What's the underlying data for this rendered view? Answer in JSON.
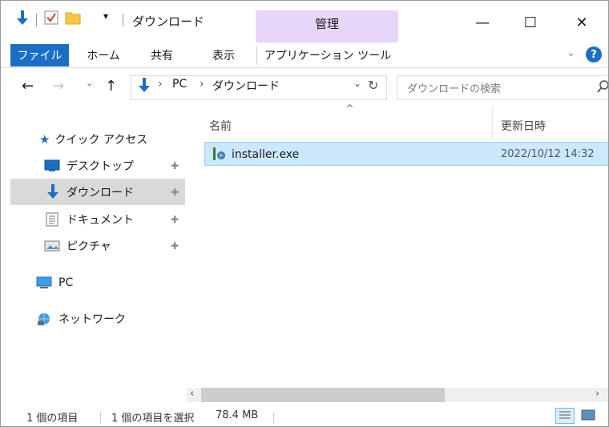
{
  "window": {
    "title": "ダウンロード",
    "context_tab": "管理",
    "controls": {
      "minimize": "—",
      "maximize": "☐",
      "close": "✕"
    }
  },
  "ribbon": {
    "tabs": [
      "ファイル",
      "ホーム",
      "共有",
      "表示",
      "アプリケーション ツール"
    ],
    "help": "?"
  },
  "address_bar": {
    "path": [
      "PC",
      "ダウンロード"
    ],
    "separator": "›"
  },
  "search": {
    "placeholder": "ダウンロードの検索"
  },
  "sidebar": {
    "quick_access": "クイック アクセス",
    "items": [
      {
        "label": "デスクトップ",
        "icon": "desktop-icon",
        "pinned": true
      },
      {
        "label": "ダウンロード",
        "icon": "download-icon",
        "pinned": true,
        "selected": true
      },
      {
        "label": "ドキュメント",
        "icon": "document-icon",
        "pinned": true
      },
      {
        "label": "ピクチャ",
        "icon": "picture-icon",
        "pinned": true
      }
    ],
    "pc": "PC",
    "network": "ネットワーク"
  },
  "file_list": {
    "columns": [
      "名前",
      "更新日時"
    ],
    "rows": [
      {
        "name": "installer.exe",
        "modified": "2022/10/12 14:32",
        "selected": true
      }
    ]
  },
  "status_bar": {
    "count": "1 個の項目",
    "selection": "1 個の項目を選択",
    "size": "78.4 MB"
  },
  "colors": {
    "accent": "#1a6fc4",
    "selection": "#cce8ff",
    "context_tab": "#e8d6f7"
  }
}
